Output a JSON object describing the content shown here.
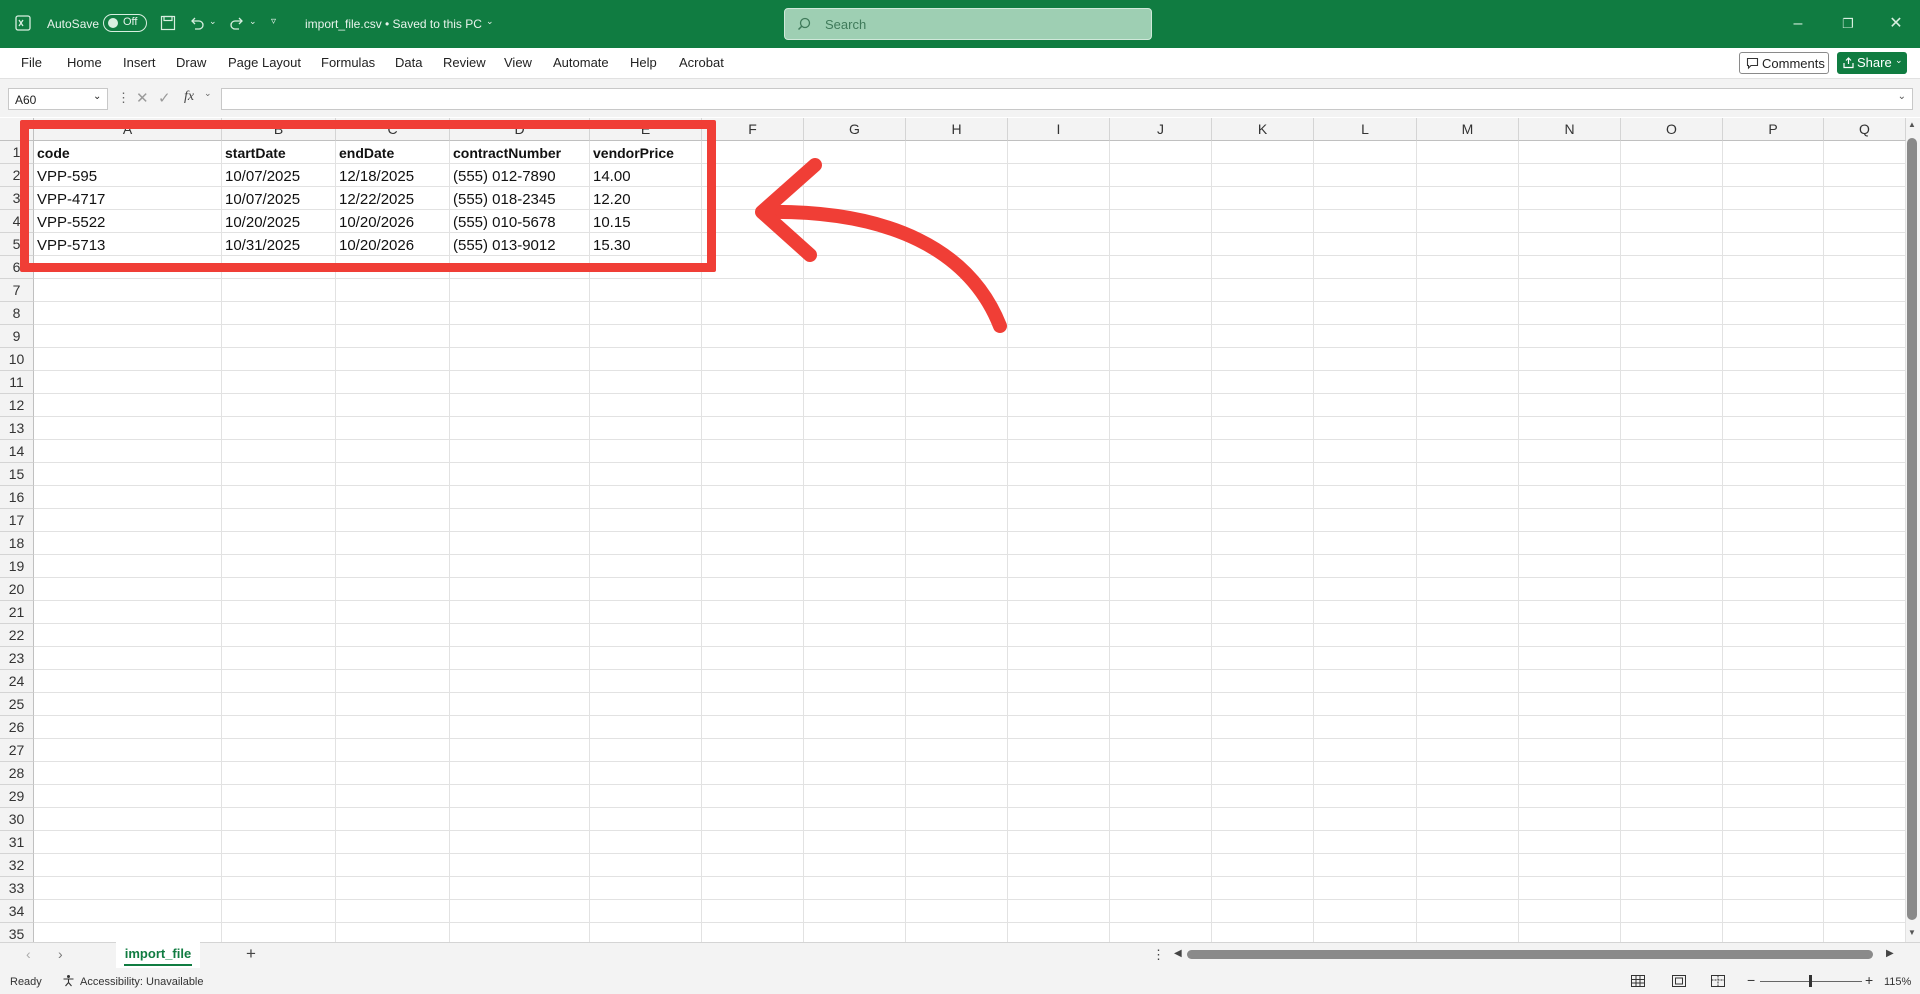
{
  "titlebar": {
    "autosave_label": "AutoSave",
    "autosave_state": "Off",
    "file_title": "import_file.csv • Saved to this PC",
    "search_placeholder": "Search"
  },
  "menu": [
    "File",
    "Home",
    "Insert",
    "Draw",
    "Page Layout",
    "Formulas",
    "Data",
    "Review",
    "View",
    "Automate",
    "Help",
    "Acrobat"
  ],
  "comments_label": "Comments",
  "share_label": "Share",
  "formula_bar": {
    "name_box": "A60",
    "fx": "fx",
    "content": ""
  },
  "columns": [
    "A",
    "B",
    "C",
    "D",
    "E",
    "F",
    "G",
    "H",
    "I",
    "J",
    "K",
    "L",
    "M",
    "N",
    "O",
    "P",
    "Q"
  ],
  "rows": [
    "1",
    "2",
    "3",
    "4",
    "5",
    "6",
    "7",
    "8",
    "9",
    "10",
    "11",
    "12",
    "13",
    "14",
    "15",
    "16",
    "17",
    "18",
    "19",
    "20",
    "21",
    "22",
    "23",
    "24",
    "25",
    "26",
    "27",
    "28",
    "29",
    "30",
    "31",
    "32",
    "33",
    "34",
    "35"
  ],
  "table": {
    "headers": [
      "code",
      "startDate",
      "endDate",
      "contractNumber",
      "vendorPrice"
    ],
    "rows": [
      [
        "VPP-595",
        "10/07/2025",
        "12/18/2025",
        "(555) 012-7890",
        "14.00"
      ],
      [
        "VPP-4717",
        "10/07/2025",
        "12/22/2025",
        "(555) 018-2345",
        "12.20"
      ],
      [
        "VPP-5522",
        "10/20/2025",
        "10/20/2026",
        "(555) 010-5678",
        "10.15"
      ],
      [
        "VPP-5713",
        "10/31/2025",
        "10/20/2026",
        "(555) 013-9012",
        "15.30"
      ]
    ]
  },
  "sheet_tab": "import_file",
  "status": {
    "ready": "Ready",
    "accessibility": "Accessibility: Unavailable",
    "zoom": "115%"
  },
  "colors": {
    "excel_green": "#107c41",
    "annotation_red": "#f03e36"
  }
}
